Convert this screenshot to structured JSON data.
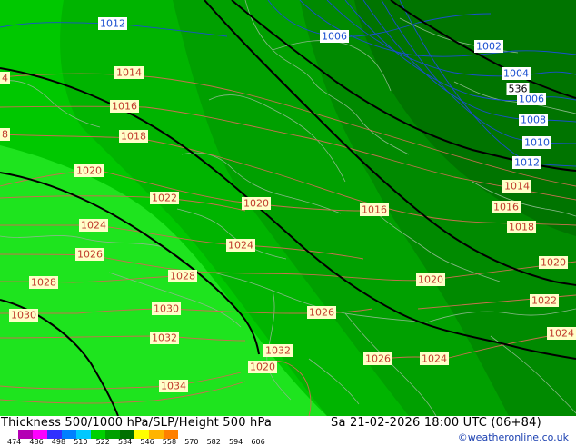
{
  "footer": {
    "title": "Thickness 500/1000 hPa/SLP/Height 500 hPa",
    "datetime": "Sa 21-02-2026 18:00 UTC (06+84)",
    "credit": "©weatheronline.co.uk"
  },
  "legend": {
    "ticks": [
      "474",
      "486",
      "498",
      "510",
      "522",
      "534",
      "546",
      "558",
      "570",
      "582",
      "594",
      "606"
    ],
    "colors": [
      "#b400b4",
      "#ff00ff",
      "#3030ff",
      "#0080ff",
      "#00c8ff",
      "#00d000",
      "#00a000",
      "#007000",
      "#ffff00",
      "#ffb400",
      "#ff8000"
    ]
  },
  "map": {
    "colors": {
      "background_green": "#00c800",
      "mid_green": "#00a500",
      "dark_green": "#008000",
      "darkest_green": "#006a00",
      "bright_green": "#1ee41e",
      "slp_isobar": "#c87050",
      "low_isobar": "#1a4fd0",
      "height_contour": "#000000",
      "borders": "#7fa07f"
    },
    "isobar_labels_red": [
      "1014",
      "1016",
      "1018",
      "1020",
      "1022",
      "1024",
      "1026",
      "1028",
      "1030",
      "1032",
      "1034",
      "1014",
      "1016",
      "1018",
      "1020",
      "1022",
      "1024",
      "1026",
      "1028",
      "1030",
      "1032",
      "1020",
      "1024",
      "1016",
      "1026",
      "1028",
      "1032",
      "1026",
      "1024",
      "1020",
      "1014",
      "1016",
      "1018",
      "1020",
      "1022",
      "1024",
      "4",
      "8"
    ],
    "isobar_labels_blue": [
      "1012",
      "1006",
      "1002",
      "1004",
      "1006",
      "1008",
      "1010",
      "1012"
    ],
    "height_labels": [
      "536"
    ]
  }
}
